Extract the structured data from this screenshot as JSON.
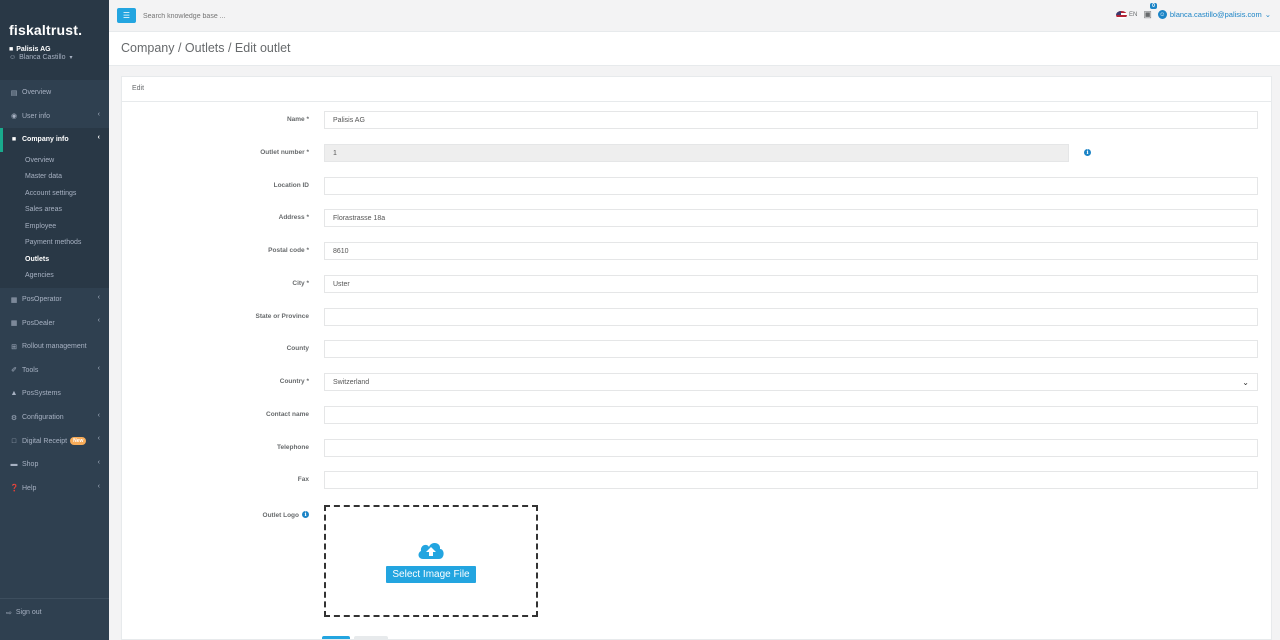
{
  "sidebar": {
    "logo": "fiskaltrust.",
    "company": "Palisis AG",
    "user": "Blanca Castillo",
    "items": [
      {
        "label": "Overview",
        "icon": "chart-icon"
      },
      {
        "label": "User info",
        "icon": "user-circle-icon"
      },
      {
        "label": "Company info",
        "icon": "briefcase-icon"
      },
      {
        "label": "PosOperator",
        "icon": "building-icon"
      },
      {
        "label": "PosDealer",
        "icon": "building-icon"
      },
      {
        "label": "Rollout management",
        "icon": "plus-square-icon"
      },
      {
        "label": "Tools",
        "icon": "wrench-icon"
      },
      {
        "label": "PosSystems",
        "icon": "sitemap-icon"
      },
      {
        "label": "Configuration",
        "icon": "cogs-icon"
      },
      {
        "label": "Digital Receipt",
        "icon": "file-icon",
        "badge": "New"
      },
      {
        "label": "Shop",
        "icon": "money-icon"
      },
      {
        "label": "Help",
        "icon": "question-icon"
      }
    ],
    "company_sub": [
      "Overview",
      "Master data",
      "Account settings",
      "Sales areas",
      "Employee",
      "Payment methods",
      "Outlets",
      "Agencies"
    ],
    "signout": "Sign out"
  },
  "topbar": {
    "search_placeholder": "Search knowledge base ...",
    "lang": "EN",
    "cart_count": "0",
    "user_email": "blanca.castillo@palisis.com"
  },
  "heading": "Company / Outlets / Edit outlet",
  "panel_title": "Edit",
  "form": {
    "name_label": "Name *",
    "name_value": "Palisis AG",
    "outlet_number_label": "Outlet number *",
    "outlet_number_value": "1",
    "location_label": "Location ID",
    "location_value": "",
    "address_label": "Address *",
    "address_value": "Florastrasse 18a",
    "postal_label": "Postal code *",
    "postal_value": "8610",
    "city_label": "City *",
    "city_value": "Uster",
    "state_label": "State or Province",
    "state_value": "",
    "county_label": "County",
    "county_value": "",
    "country_label": "Country *",
    "country_value": "Switzerland",
    "contact_label": "Contact name",
    "contact_value": "",
    "telephone_label": "Telephone",
    "telephone_value": "",
    "fax_label": "Fax",
    "fax_value": "",
    "logo_label": "Outlet Logo",
    "upload_label": "Select Image File"
  },
  "colors": {
    "accent": "#23a5e0",
    "sidebar": "#2f4050",
    "info": "#1c84c6"
  }
}
